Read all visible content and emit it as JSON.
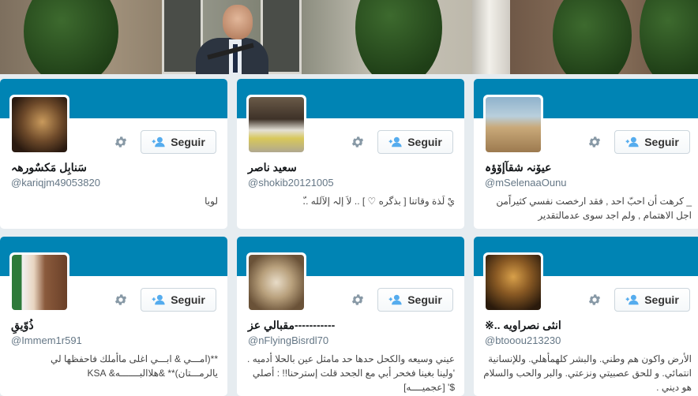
{
  "follow_label": "Seguir",
  "colors": {
    "banner": "#0084b4",
    "background": "#e6ecf0",
    "accent": "#0084b4"
  },
  "icons": {
    "gear": "gear-icon",
    "follow": "person-plus-icon"
  },
  "cards": [
    {
      "name": "سَنابِل مَكسٌورهہ",
      "handle": "@kariqjm49053820",
      "bio": "لويا"
    },
    {
      "name": "سعيد ناصر",
      "handle": "@shokib20121005",
      "bio": "يْ لَذة وقاتنا [ بذگره ♡ ] .. لاَ إلہ إلآلله ..ّ"
    },
    {
      "name": "عيۆنہ شقآإۆؤہ",
      "handle": "@mSelenaaOunu",
      "bio": "_ كرهت أن احبّ احد , فقد ارخصت نفسي كثيراًمن اجل الاهتمام , ولم اجد سوى عدمالتقدير"
    },
    {
      "name": "ذُوّيقِ",
      "handle": "@Immem1r591",
      "bio": "**(امـــي & ابـــي اغلى ماأملك فاحفظها لي يالرمـــتان)** &هلاالبـــــــه& KSA"
    },
    {
      "name": "مقبالي عز-----------",
      "handle": "@nFlyingBisrdl70",
      "bio": "عيني وسيعه والكحل حدها حد مامثل عين بالحلا أدميه . 'ولينا بغينا فخحر أبي مع الجحد قلت إسترحنا!! : أصلي $' [عجميــــه]"
    },
    {
      "name": "※.. انثى نصراويه",
      "handle": "@btooou213230",
      "bio": "الأرض واكون هم وطني. والبشر كلهمأهلي. وللإنسانية انتمائي. و للحق عصبيتي ونزعتي. والبر والحب والسلام هو ديني ."
    }
  ]
}
